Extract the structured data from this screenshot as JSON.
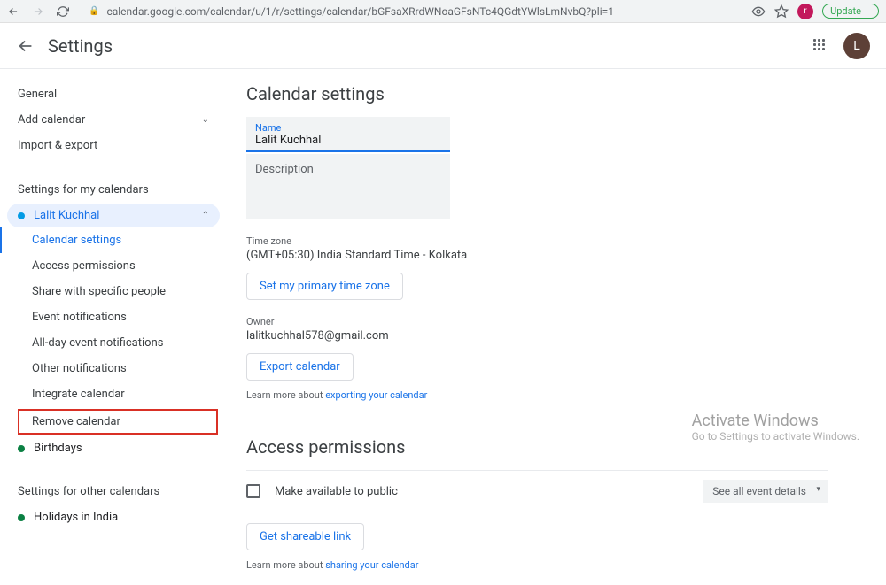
{
  "url": "calendar.google.com/calendar/u/1/r/settings/calendar/bGFsaXRrdWNoaGFsNTc4QGdtYWlsLmNvbQ?pli=1",
  "update_label": "Update",
  "profile_initial": "r",
  "avatar_initial": "L",
  "header": {
    "title": "Settings"
  },
  "sidebar": {
    "general": "General",
    "add_calendar": "Add calendar",
    "import_export": "Import & export",
    "my_calendars_heading": "Settings for my calendars",
    "cal1_name": "Lalit Kuchhal",
    "cal1_color": "#039be5",
    "subs": {
      "calendar_settings": "Calendar settings",
      "access_permissions": "Access permissions",
      "share_specific": "Share with specific people",
      "event_notifications": "Event notifications",
      "all_day_notifications": "All-day event notifications",
      "other_notifications": "Other notifications",
      "integrate_calendar": "Integrate calendar",
      "remove_calendar": "Remove calendar"
    },
    "cal2_name": "Birthdays",
    "cal2_color": "#0b8043",
    "other_heading": "Settings for other calendars",
    "cal3_name": "Holidays in India",
    "cal3_color": "#0b8043"
  },
  "main": {
    "section_title": "Calendar settings",
    "name_label": "Name",
    "name_value": "Lalit Kuchhal",
    "description_label": "Description",
    "timezone_label": "Time zone",
    "timezone_value": "(GMT+05:30) India Standard Time - Kolkata",
    "set_timezone_btn": "Set my primary time zone",
    "owner_label": "Owner",
    "owner_value": "lalitkuchhal578@gmail.com",
    "export_btn": "Export calendar",
    "learn_export_prefix": "Learn more about ",
    "learn_export_link": "exporting your calendar",
    "access_title": "Access permissions",
    "make_public": "Make available to public",
    "event_details_dd": "See all event details",
    "shareable_btn": "Get shareable link",
    "learn_share_prefix": "Learn more about ",
    "learn_share_link": "sharing your calendar"
  },
  "watermark": {
    "title": "Activate Windows",
    "sub": "Go to Settings to activate Windows."
  }
}
